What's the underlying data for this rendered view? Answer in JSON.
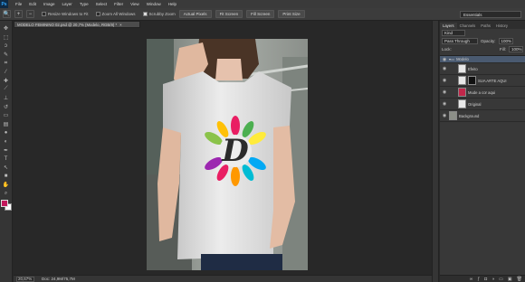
{
  "app": {
    "logo": "Ps"
  },
  "menu": [
    "File",
    "Edit",
    "Image",
    "Layer",
    "Type",
    "Select",
    "Filter",
    "View",
    "Window",
    "Help"
  ],
  "options": {
    "tool_icon": "zoom-icon",
    "resize_windows": "Resize Windows to Fit",
    "zoom_all_windows": "Zoom All Windows",
    "scrubby_zoom": "Scrubby Zoom",
    "actual_pixels": "Actual Pixels",
    "fit_screen": "Fit Screen",
    "fill_screen": "Fill Screen",
    "print_size": "Print Size",
    "workspace": "Essentials"
  },
  "document": {
    "tab_title": "MODELO FEMININO 02.psd @ 20,7% (Modelo, RGB/8) *",
    "tab_close": "×"
  },
  "status": {
    "zoom": "20,67%",
    "doc_info": "Doc: 24,9M/75,7M"
  },
  "toolbar": {
    "tools": [
      "move-icon",
      "marquee-icon",
      "lasso-icon",
      "quick-select-icon",
      "crop-icon",
      "eyedropper-icon",
      "healing-icon",
      "brush-icon",
      "stamp-icon",
      "history-brush-icon",
      "eraser-icon",
      "gradient-icon",
      "blur-icon",
      "dodge-icon",
      "pen-icon",
      "type-icon",
      "path-select-icon",
      "shape-icon",
      "hand-icon",
      "zoom-icon"
    ],
    "foreground_color": "#c2185b",
    "background_color": "#ffffff"
  },
  "design": {
    "letter": "D",
    "petal_colors": [
      "#e91e63",
      "#ff9800",
      "#ffeb3b",
      "#8bc34a",
      "#03a9f4",
      "#9c27b0"
    ]
  },
  "layers_panel": {
    "tabs": [
      "Layers",
      "Channels",
      "Paths",
      "History"
    ],
    "kind": "Kind",
    "blend_mode": "Pass Through",
    "opacity_label": "Opacity:",
    "opacity_value": "100%",
    "lock_label": "Lock:",
    "fill_label": "Fill:",
    "fill_value": "100%",
    "layers": [
      {
        "name": "Modelo",
        "kind": "group"
      },
      {
        "name": "Efeito",
        "kind": "layer"
      },
      {
        "name": "SUA ARTE AQUI",
        "kind": "smart"
      },
      {
        "name": "Mude a cor aqui",
        "kind": "fill"
      },
      {
        "name": "Original",
        "kind": "layer"
      },
      {
        "name": "Background",
        "kind": "background"
      }
    ]
  }
}
